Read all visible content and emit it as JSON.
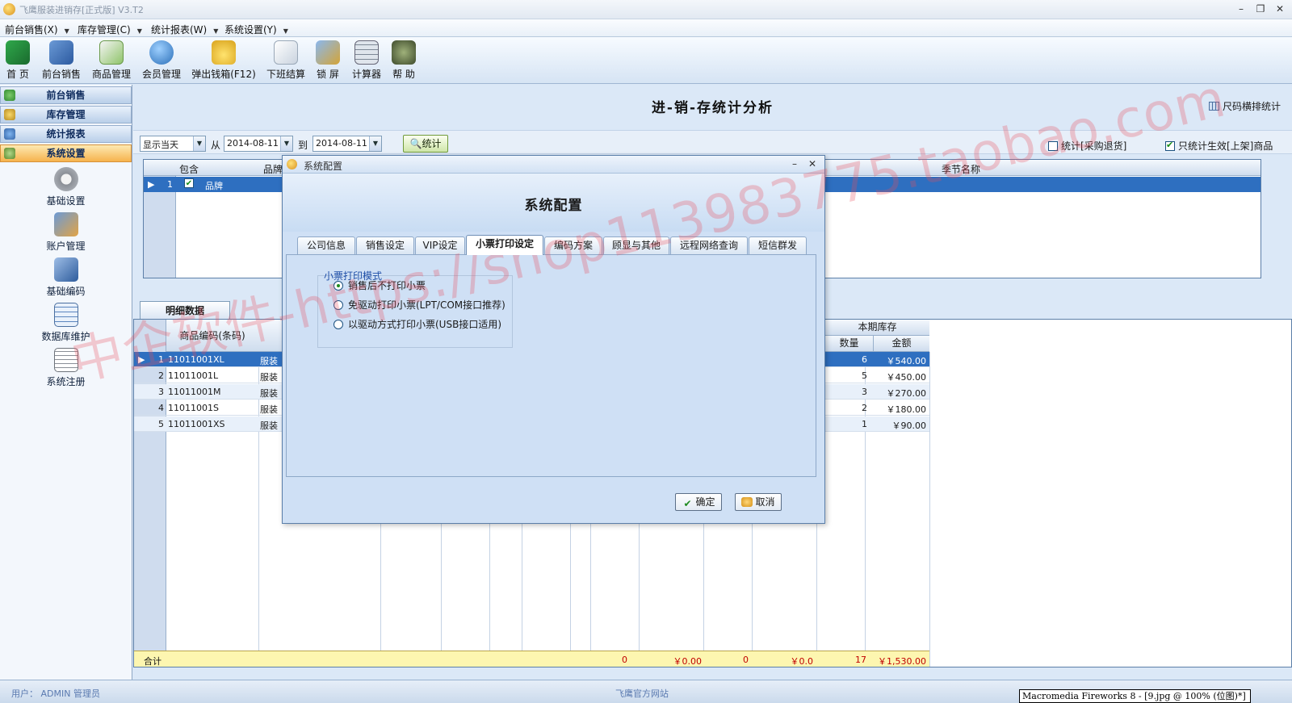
{
  "window": {
    "title": "飞鹰服装进销存[正式版] V3.T2",
    "min": "–",
    "max": "❐",
    "close": "✕"
  },
  "menu": [
    {
      "label": "前台销售(X)"
    },
    {
      "label": "库存管理(C)"
    },
    {
      "label": "统计报表(W)"
    },
    {
      "label": "系统设置(Y)"
    }
  ],
  "toolbar": [
    {
      "label": "首 页",
      "icon": "home-icon"
    },
    {
      "label": "前台销售",
      "icon": "sales-icon"
    },
    {
      "label": "商品管理",
      "icon": "goods-icon"
    },
    {
      "label": "会员管理",
      "icon": "member-icon"
    },
    {
      "label": "弹出钱箱(F12)",
      "icon": "cash-drawer-icon"
    },
    {
      "label": "下班结算",
      "icon": "settle-icon"
    },
    {
      "label": "锁 屏",
      "icon": "lock-screen-icon"
    },
    {
      "label": "计算器",
      "icon": "calculator-icon"
    },
    {
      "label": "帮 助",
      "icon": "help-icon"
    }
  ],
  "sidebar": {
    "sections": [
      {
        "label": "前台销售"
      },
      {
        "label": "库存管理"
      },
      {
        "label": "统计报表"
      },
      {
        "label": "系统设置"
      }
    ],
    "tools": [
      {
        "label": "基础设置",
        "icon": "basic-settings-icon"
      },
      {
        "label": "账户管理",
        "icon": "account-icon"
      },
      {
        "label": "基础编码",
        "icon": "code-icon"
      },
      {
        "label": "数据库维护",
        "icon": "database-icon"
      },
      {
        "label": "系统注册",
        "icon": "register-icon"
      }
    ]
  },
  "main": {
    "title": "进-销-存统计分析",
    "size_stat": "尺码横排统计",
    "filter": {
      "range": "显示当天",
      "from_label": "从",
      "from": "2014-08-11",
      "to_label": "到",
      "to": "2014-08-11",
      "stat_button": "统计",
      "chk_purchase_return": "统计[采购退货]",
      "chk_active_only": "只统计生效[上架]商品"
    },
    "grid1": {
      "headers": {
        "include": "包含",
        "brand": "品牌",
        "season": "季节名称"
      },
      "row": {
        "index": "1",
        "name": "品牌"
      }
    },
    "detail_tab": "明细数据",
    "grid2": {
      "header_code": "商品编码(条码)",
      "header_stock": "本期库存",
      "header_qty": "数量",
      "header_amount": "金额",
      "rows": [
        {
          "index": "1",
          "code": "11011001XL",
          "cat": "服装",
          "qty": "6",
          "amount": "￥540.00"
        },
        {
          "index": "2",
          "code": "11011001L",
          "cat": "服装",
          "qty": "5",
          "amount": "￥450.00"
        },
        {
          "index": "3",
          "code": "11011001M",
          "cat": "服装",
          "qty": "3",
          "amount": "￥270.00"
        },
        {
          "index": "4",
          "code": "11011001S",
          "cat": "服装",
          "qty": "2",
          "amount": "￥180.00"
        },
        {
          "index": "5",
          "code": "11011001XS",
          "cat": "服装",
          "qty": "1",
          "amount": "￥90.00"
        }
      ],
      "total": {
        "label": "合计",
        "v1": "0",
        "v2": "￥0.00",
        "v3": "0",
        "v4": "￥0.0",
        "v5": "17",
        "v6": "￥1,530.00"
      }
    }
  },
  "dialog": {
    "title": "系统配置",
    "heading": "系统配置",
    "min": "–",
    "close": "✕",
    "tabs": [
      {
        "label": "公司信息"
      },
      {
        "label": "销售设定"
      },
      {
        "label": "VIP设定"
      },
      {
        "label": "小票打印设定"
      },
      {
        "label": "编码方案"
      },
      {
        "label": "顾显与其他"
      },
      {
        "label": "远程网络查询"
      },
      {
        "label": "短信群发"
      }
    ],
    "group_label": "小票打印模式",
    "options": [
      {
        "label": "销售后不打印小票"
      },
      {
        "label": "免驱动打印小票(LPT/COM接口推荐)"
      },
      {
        "label": "以驱动方式打印小票(USB接口适用)"
      }
    ],
    "ok": "确定",
    "cancel": "取消"
  },
  "status": {
    "user": "用户： ADMIN 管理员",
    "site": "飞鹰官方网站",
    "fw": "Macromedia Fireworks 8 - [9.jpg @ 100% (位图)*]"
  },
  "watermark": "中企软件-https://shop113983775.taobao.com",
  "colors": {
    "accent": "#2e6fc0",
    "panel": "#dbe8f7",
    "total_bg": "#fdf6b0"
  }
}
